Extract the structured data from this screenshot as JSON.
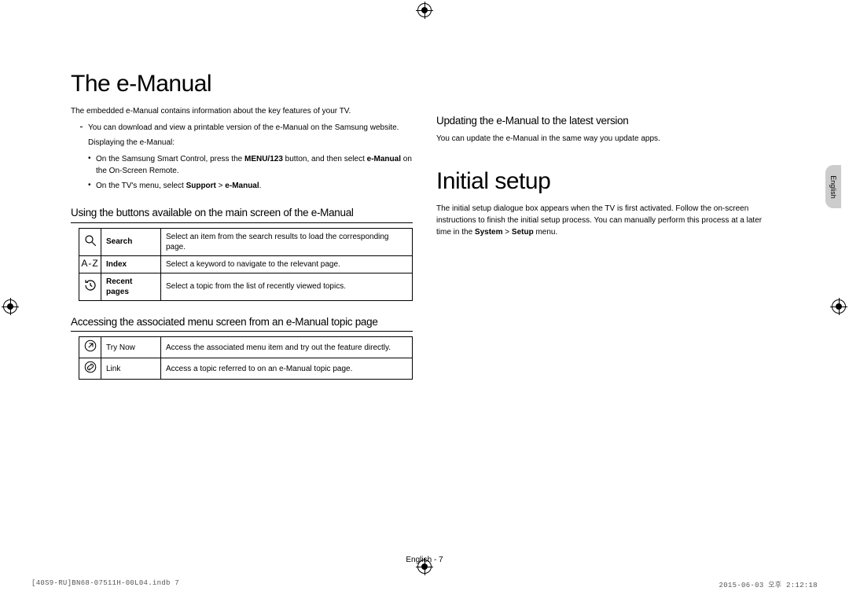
{
  "lang_tab": "English",
  "left": {
    "h1": "The e-Manual",
    "intro": "The embedded e-Manual contains information about the key features of your TV.",
    "bullet_download": "You can download and view a printable version of the e-Manual on the Samsung website.",
    "display_note": "Displaying the e-Manual:",
    "sub1_a": "On the Samsung Smart Control, press the ",
    "sub1_b": "MENU/123",
    "sub1_c": " button, and then select ",
    "sub1_d": "e-Manual",
    "sub1_e": " on the On-Screen Remote.",
    "sub2_a": "On the TV's menu, select ",
    "sub2_b": "Support",
    "sub2_c": " > ",
    "sub2_d": "e-Manual",
    "sub2_e": ".",
    "h2_buttons": "Using the buttons available on the main screen of the e-Manual",
    "table1": {
      "r1_label": "Search",
      "r1_desc": "Select an item from the search results to load the corresponding page.",
      "r2_icon": "A-Z",
      "r2_label": "Index",
      "r2_desc": "Select a keyword to navigate to the relevant page.",
      "r3_label": "Recent pages",
      "r3_desc": "Select a topic from the list of recently viewed topics."
    },
    "h2_access": "Accessing the associated menu screen from an e-Manual topic page",
    "table2": {
      "r1_label": "Try Now",
      "r1_desc": "Access the associated menu item and try out the feature directly.",
      "r2_label": "Link",
      "r2_desc": "Access a topic referred to on an e-Manual topic page."
    }
  },
  "right": {
    "h2_update": "Updating the e-Manual to the latest version",
    "update_text": "You can update the e-Manual in the same way you update apps.",
    "h1": "Initial setup",
    "para_a": "The initial setup dialogue box appears when the TV is first activated. Follow the on-screen instructions to finish the initial setup process. You can manually perform this process at a later time in the ",
    "para_b": "System",
    "para_c": " > ",
    "para_d": "Setup",
    "para_e": " menu."
  },
  "footer_center": "English - 7",
  "footer_left": "[40S9-RU]BN68-07511H-00L04.indb   7",
  "footer_right": "2015-06-03   오후 2:12:18"
}
